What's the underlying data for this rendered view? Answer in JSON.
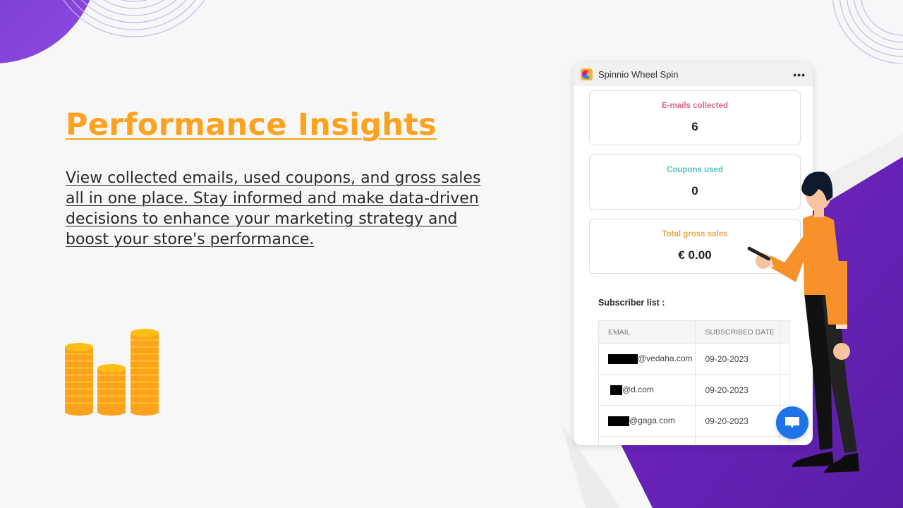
{
  "slide": {
    "title": "Performance Insights",
    "description": "View collected emails, used coupons, and gross sales all in one place. Stay informed and make data-driven decisions to enhance your marketing strategy and boost your store's performance."
  },
  "colors": {
    "accent_orange": "#fda21f",
    "brand_purple": "#6a22b8",
    "emails_label": "#e0638c",
    "coupons_label": "#4fc3c3",
    "sales_label": "#f0a64a",
    "chat_button": "#1f73e8"
  },
  "app": {
    "name": "Spinnio Wheel Spin",
    "icon": "spinnio-wheel-icon",
    "more_menu": "•••"
  },
  "stats": [
    {
      "label": "E-mails collected",
      "value": "6"
    },
    {
      "label": "Coupons used",
      "value": "0"
    },
    {
      "label": "Total gross sales",
      "value": "€ 0.00"
    }
  ],
  "subscribers": {
    "title": "Subscriber list :",
    "columns": [
      "EMAIL",
      "SUBSCRIBED DATE"
    ],
    "rows": [
      {
        "email_visible": "@vedaha.com",
        "date": "09-20-2023"
      },
      {
        "email_visible": "@d.com",
        "date": "09-20-2023"
      },
      {
        "email_visible": "@gaga.com",
        "date": "09-20-2023"
      }
    ]
  },
  "chat": {
    "icon": "chat-bubble-icon"
  }
}
